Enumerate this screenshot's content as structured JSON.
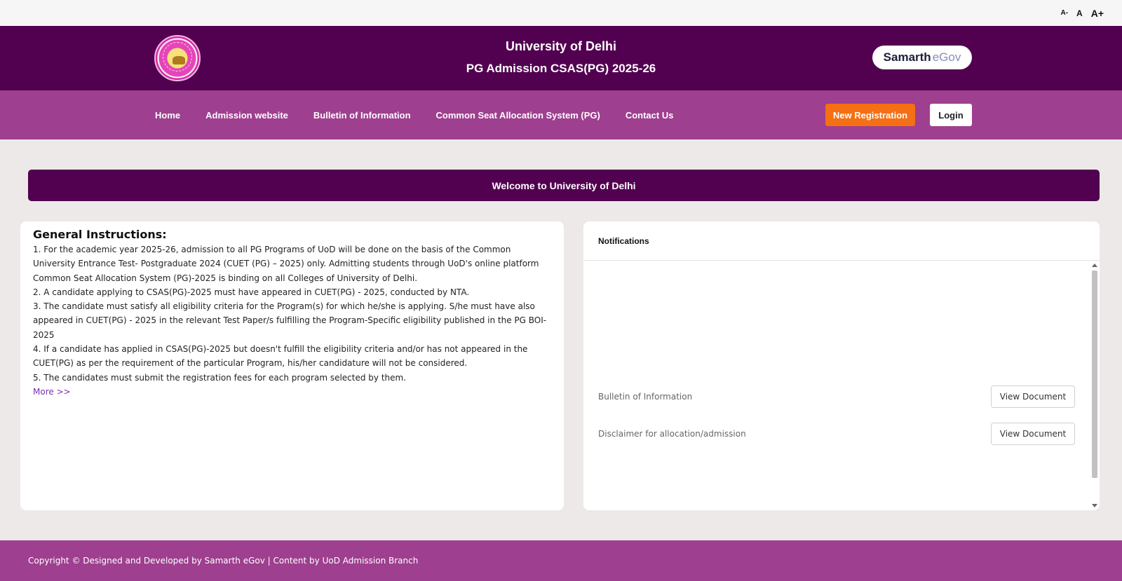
{
  "font_controls": {
    "decrease": "A-",
    "normal": "A",
    "increase": "A+"
  },
  "header": {
    "university": "University of Delhi",
    "subtitle": "PG Admission CSAS(PG) 2025-26",
    "brand_part1": "Samarth",
    "brand_part2": "eGov"
  },
  "nav": {
    "links": [
      "Home",
      "Admission website",
      "Bulletin of Information",
      "Common Seat Allocation System (PG)",
      "Contact Us"
    ],
    "new_registration": "New Registration",
    "login": "Login"
  },
  "welcome": "Welcome to University of Delhi",
  "instructions": {
    "title": "General Instructions:",
    "items": [
      "1. For the academic year 2025-26, admission to all PG Programs of UoD will be done on the basis of the Common University Entrance Test- Postgraduate 2024 (CUET (PG) – 2025) only. Admitting students through UoD's online platform Common Seat Allocation System (PG)-2025 is binding on all Colleges of University of Delhi.",
      "2. A candidate applying to CSAS(PG)-2025 must have appeared in CUET(PG) - 2025, conducted by NTA.",
      "3. The candidate must satisfy all eligibility criteria for the Program(s) for which he/she is applying. S/he must have also appeared in CUET(PG) - 2025 in the relevant Test Paper/s fulfilling the Program-Specific eligibility published in the PG BOI-2025",
      "4. If a candidate has applied in CSAS(PG)-2025 but doesn't fulfill the eligibility criteria and/or has not appeared in the CUET(PG) as per the requirement of the particular Program, his/her candidature will not be considered.",
      "5. The candidates must submit the registration fees for each program selected by them."
    ],
    "more": "More >>"
  },
  "notifications": {
    "title": "Notifications",
    "items": [
      {
        "label": "Bulletin of Information",
        "button": "View Document"
      },
      {
        "label": "Disclaimer for allocation/admission",
        "button": "View Document"
      }
    ]
  },
  "footer": "Copyright © Designed and Developed by Samarth eGov | Content by UoD Admission Branch",
  "colors": {
    "header_bg": "#520050",
    "nav_bg": "#9e3f8f",
    "accent_orange": "#f56f14",
    "page_bg": "#ede9e8"
  }
}
